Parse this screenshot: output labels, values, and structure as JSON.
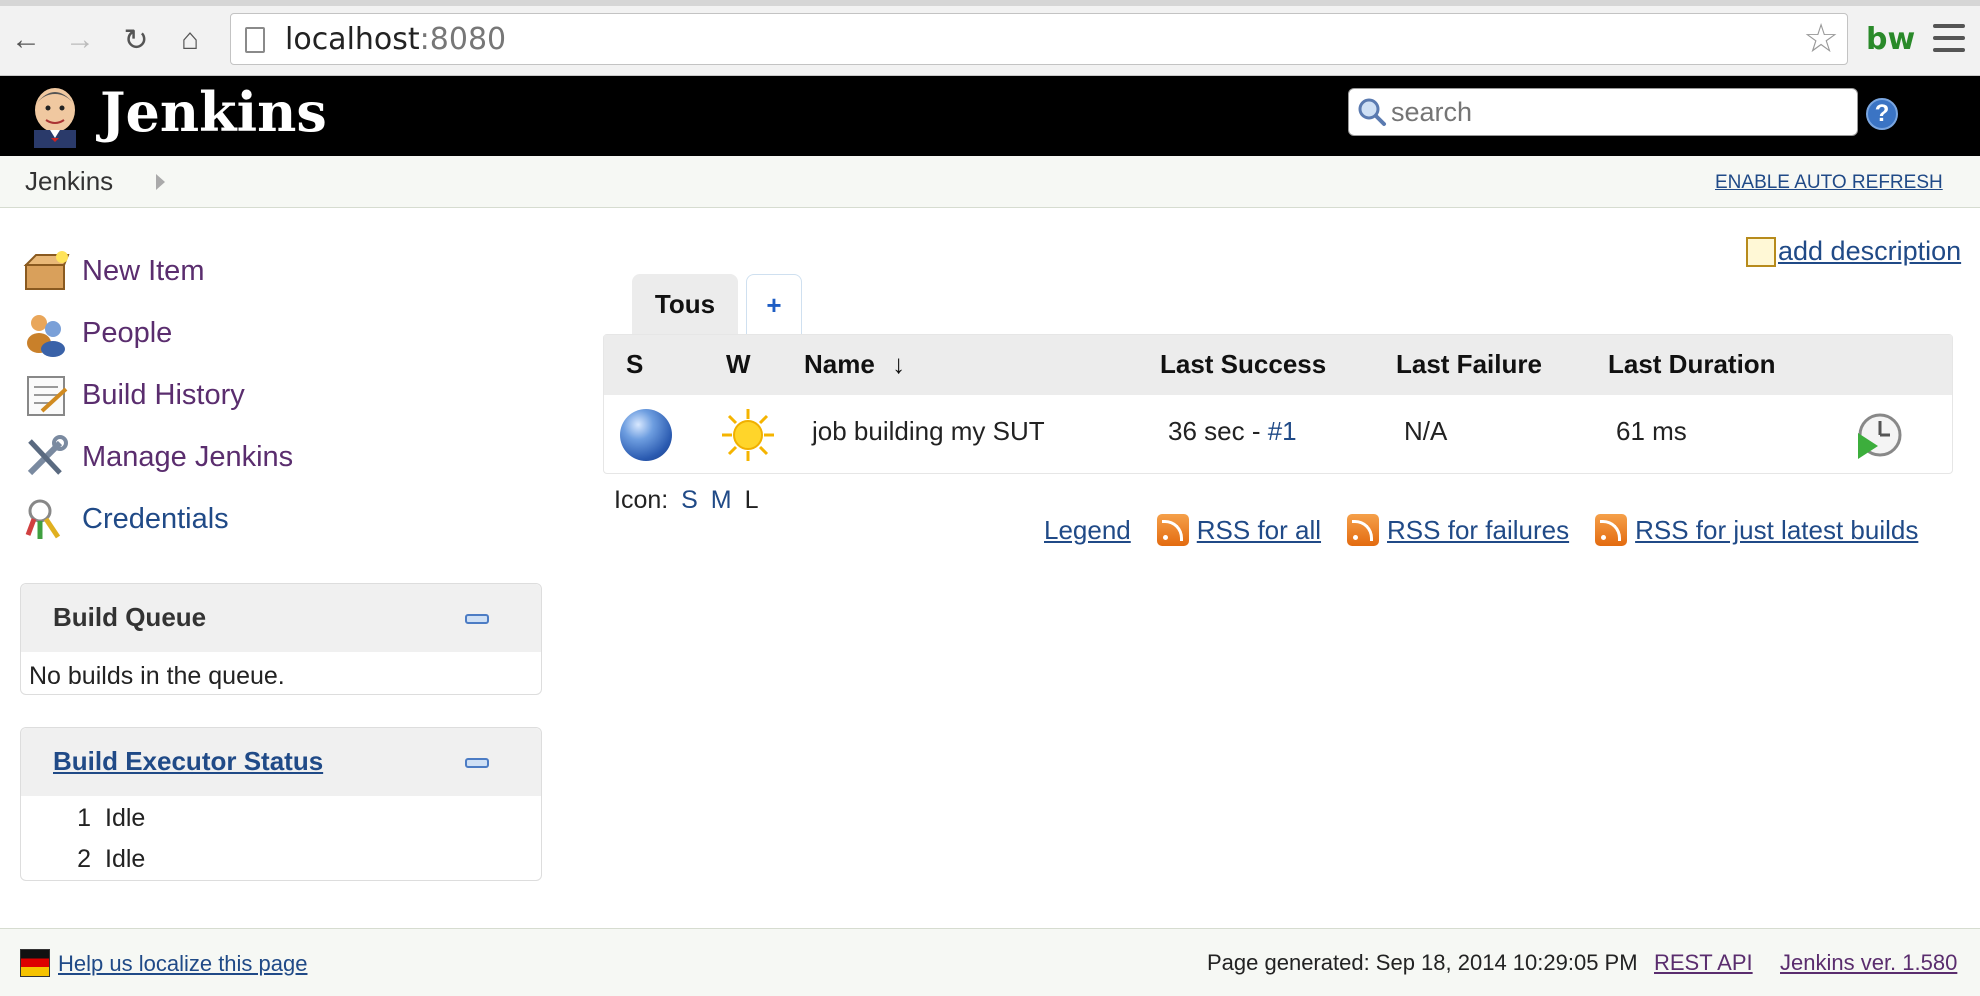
{
  "browser": {
    "url_host": "localhost",
    "url_port": ":8080",
    "extension_label": "bw"
  },
  "header": {
    "brand": "Jenkins",
    "search_placeholder": "search",
    "help_label": "?"
  },
  "breadcrumb": {
    "root": "Jenkins",
    "auto_refresh": "ENABLE AUTO REFRESH"
  },
  "sidebar": {
    "items": [
      {
        "label": "New Item",
        "icon": "new-item-icon"
      },
      {
        "label": "People",
        "icon": "people-icon"
      },
      {
        "label": "Build History",
        "icon": "build-history-icon"
      },
      {
        "label": "Manage Jenkins",
        "icon": "manage-jenkins-icon"
      },
      {
        "label": "Credentials",
        "icon": "credentials-icon"
      }
    ],
    "build_queue": {
      "title": "Build Queue",
      "empty_text": "No builds in the queue."
    },
    "executors": {
      "title": "Build Executor Status",
      "rows": [
        {
          "num": "1",
          "status": "Idle"
        },
        {
          "num": "2",
          "status": "Idle"
        }
      ]
    }
  },
  "main": {
    "add_description": "add description",
    "tabs": {
      "active": "Tous",
      "add": "+"
    },
    "columns": {
      "s": "S",
      "w": "W",
      "name": "Name",
      "sort_arrow": "↓",
      "last_success": "Last Success",
      "last_failure": "Last Failure",
      "last_duration": "Last Duration"
    },
    "job": {
      "name": "job building my SUT",
      "last_success_text": "36 sec - ",
      "last_success_build": "#1",
      "last_failure": "N/A",
      "last_duration": "61 ms",
      "status_color": "blue",
      "weather": "sunny"
    },
    "icon_size": {
      "label": "Icon:",
      "s": "S",
      "m": "M",
      "l": "L"
    },
    "links": {
      "legend": "Legend",
      "rss_all": "RSS for all",
      "rss_failures": "RSS for failures",
      "rss_latest": "RSS for just latest builds"
    }
  },
  "footer": {
    "localize": "Help us localize this page",
    "generated": "Page generated: Sep 18, 2014 10:29:05 PM",
    "rest_api": "REST API",
    "version": "Jenkins ver. 1.580"
  }
}
